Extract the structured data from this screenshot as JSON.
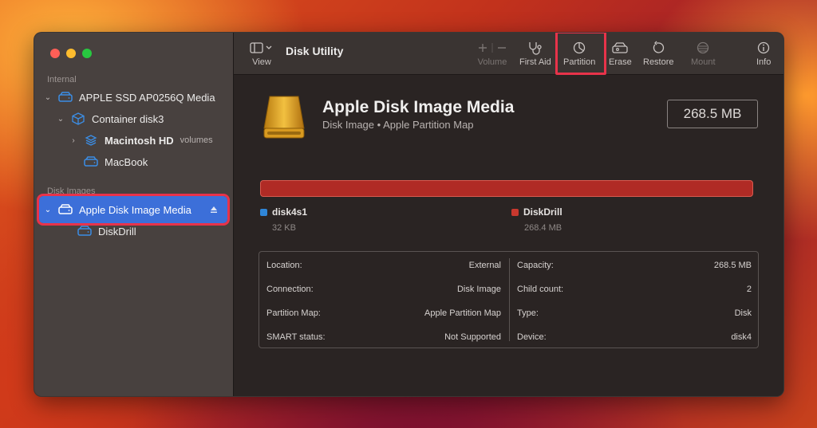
{
  "app": {
    "title": "Disk Utility"
  },
  "sidebar": {
    "sections": {
      "internal": "Internal",
      "disk_images": "Disk Images"
    },
    "items": [
      {
        "label": "APPLE SSD AP0256Q Media"
      },
      {
        "label": "Container disk3"
      },
      {
        "label": "Macintosh HD",
        "meta": "volumes"
      },
      {
        "label": "MacBook"
      },
      {
        "label": "Apple Disk Image Media"
      },
      {
        "label": "DiskDrill"
      }
    ]
  },
  "toolbar": {
    "view": "View",
    "volume": "Volume",
    "first_aid": "First Aid",
    "partition": "Partition",
    "erase": "Erase",
    "restore": "Restore",
    "mount": "Mount",
    "info": "Info"
  },
  "disk": {
    "name": "Apple Disk Image Media",
    "subtitle": "Disk Image • Apple Partition Map",
    "size": "268.5 MB"
  },
  "partitions": [
    {
      "name": "disk4s1",
      "size": "32 KB",
      "color": "#2f86d8"
    },
    {
      "name": "DiskDrill",
      "size": "268.4 MB",
      "color": "#c8382e"
    }
  ],
  "info_left": [
    {
      "label": "Location:",
      "value": "External"
    },
    {
      "label": "Connection:",
      "value": "Disk Image"
    },
    {
      "label": "Partition Map:",
      "value": "Apple Partition Map"
    },
    {
      "label": "SMART status:",
      "value": "Not Supported"
    }
  ],
  "info_right": [
    {
      "label": "Capacity:",
      "value": "268.5 MB"
    },
    {
      "label": "Child count:",
      "value": "2"
    },
    {
      "label": "Type:",
      "value": "Disk"
    },
    {
      "label": "Device:",
      "value": "disk4"
    }
  ],
  "colors": {
    "accent": "#3c6fd9",
    "highlight": "#e8334a",
    "disk_icon": "#e0a020"
  }
}
